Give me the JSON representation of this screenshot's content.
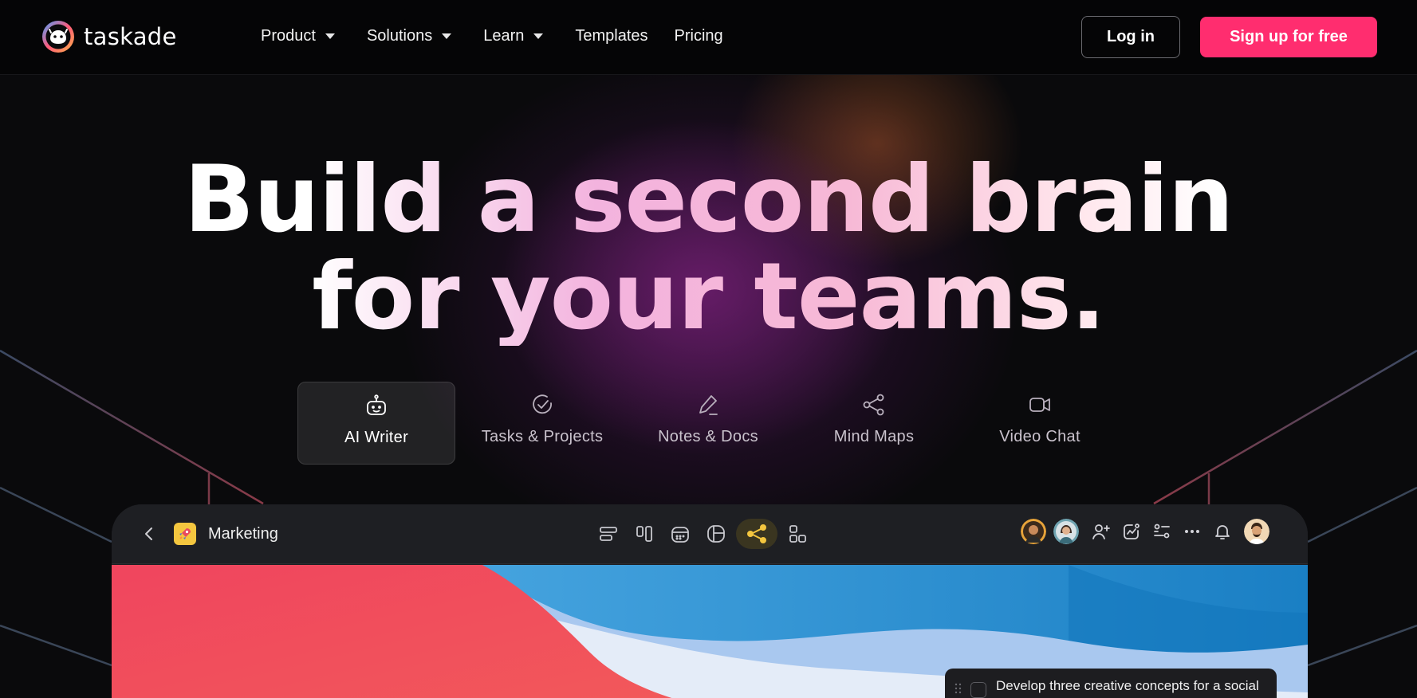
{
  "brand": {
    "name": "taskade"
  },
  "nav": {
    "items": [
      {
        "label": "Product",
        "dropdown": true
      },
      {
        "label": "Solutions",
        "dropdown": true
      },
      {
        "label": "Learn",
        "dropdown": true
      },
      {
        "label": "Templates",
        "dropdown": false
      },
      {
        "label": "Pricing",
        "dropdown": false
      }
    ],
    "login_label": "Log in",
    "signup_label": "Sign up for free"
  },
  "hero": {
    "line1": "Build a second brain",
    "line2": "for your teams."
  },
  "features": [
    {
      "label": "AI Writer",
      "icon": "robot-icon",
      "active": true
    },
    {
      "label": "Tasks & Projects",
      "icon": "check-circle-icon",
      "active": false
    },
    {
      "label": "Notes & Docs",
      "icon": "pencil-icon",
      "active": false
    },
    {
      "label": "Mind Maps",
      "icon": "share-nodes-icon",
      "active": false
    },
    {
      "label": "Video Chat",
      "icon": "video-camera-icon",
      "active": false
    }
  ],
  "app": {
    "project_name": "Marketing",
    "project_icon": "rocket-icon",
    "views": [
      "list-view-icon",
      "board-view-icon",
      "calendar-view-icon",
      "table-view-icon",
      "mindmap-view-icon",
      "org-chart-view-icon"
    ],
    "active_view": "mindmap-view-icon",
    "task_text": "Develop three creative concepts for a social"
  },
  "colors": {
    "accent": "#ff2d6f",
    "background": "#0a0a0c",
    "active_view": "#f4c63f"
  }
}
